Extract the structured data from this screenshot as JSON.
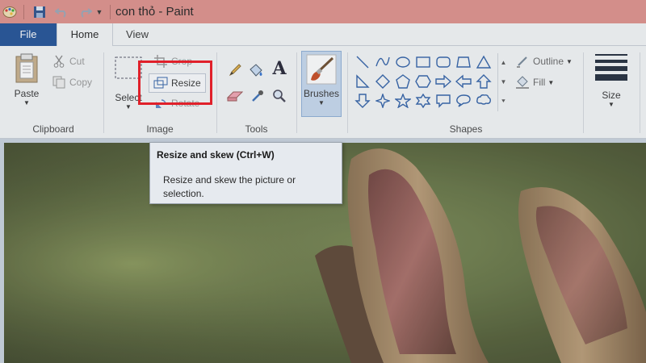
{
  "window": {
    "title": "con thỏ - Paint"
  },
  "quick_access": {
    "icons": [
      "paint-app-icon",
      "save-icon",
      "undo-icon",
      "redo-icon",
      "customize-dropdown-icon"
    ]
  },
  "menu": {
    "tabs": [
      "File",
      "Home",
      "View"
    ]
  },
  "ribbon": {
    "clipboard": {
      "label": "Clipboard",
      "paste": "Paste",
      "cut": "Cut",
      "copy": "Copy"
    },
    "image": {
      "label": "Image",
      "select": "Select",
      "crop": "Crop",
      "resize": "Resize",
      "rotate": "Rotate"
    },
    "tools": {
      "label": "Tools",
      "icons": [
        "pencil-icon",
        "fill-icon",
        "text-icon",
        "eraser-icon",
        "color-picker-icon",
        "magnifier-icon"
      ]
    },
    "brushes": {
      "label": "Brushes"
    },
    "shapes": {
      "label": "Shapes",
      "outline": "Outline",
      "fill": "Fill"
    },
    "size": {
      "label": "Size"
    }
  },
  "tooltip": {
    "title": "Resize and skew (Ctrl+W)",
    "body": "Resize and skew the picture or selection."
  },
  "canvas": {
    "image": "rabbit-photo"
  }
}
